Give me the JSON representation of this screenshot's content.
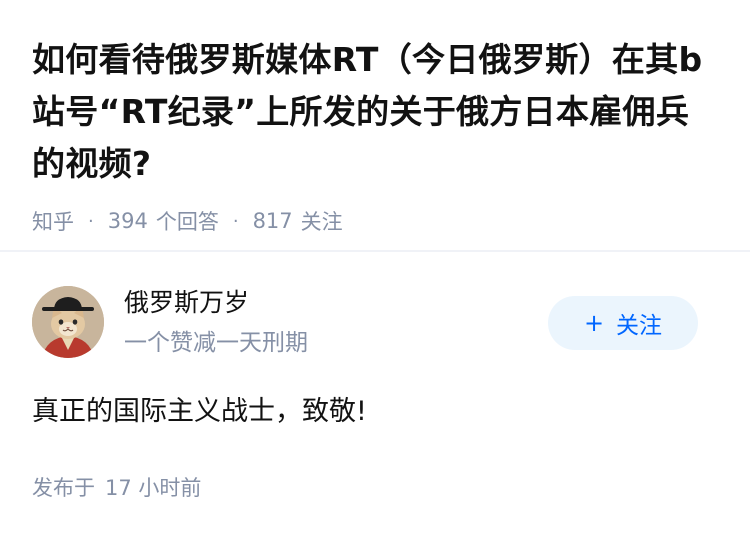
{
  "question": {
    "title": "如何看待俄罗斯媒体RT（今日俄罗斯）在其b站号“RT纪录”上所发的关于俄方日本雇佣兵的视频?",
    "source": "知乎",
    "answer_count": "394",
    "answer_count_label": "个回答",
    "follower_count": "817",
    "follower_count_label": "关注"
  },
  "author": {
    "name": "俄罗斯万岁",
    "bio": "一个赞减一天刑期",
    "avatar_icon": "cat-in-hat-avatar",
    "follow_label": "关注"
  },
  "answer": {
    "content": "真正的国际主义战士，致敬!"
  },
  "footer": {
    "posted_label": "发布于",
    "posted_time": "17 小时前"
  },
  "colors": {
    "text": "#121212",
    "meta": "#8590a6",
    "accent": "#0066ff",
    "follow_bg": "#ebf5fd"
  }
}
